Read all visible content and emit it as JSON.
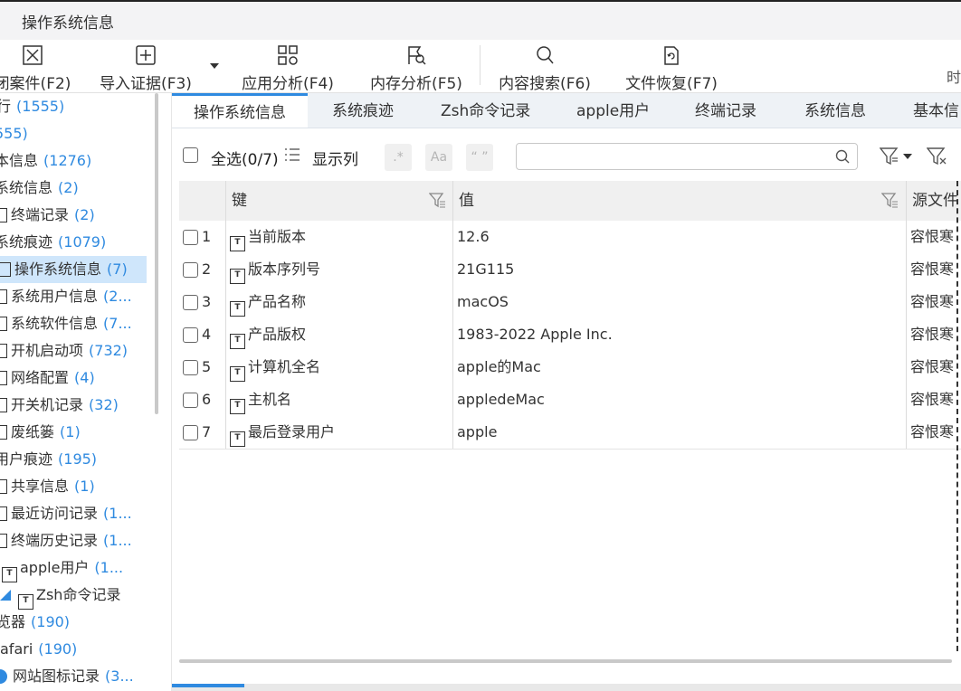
{
  "window": {
    "title": "操作系统信息"
  },
  "toolbar": {
    "buttons": [
      {
        "label": "闭案件(F2)",
        "icon": "close-box-icon"
      },
      {
        "label": "导入证据(F3)",
        "icon": "plus-box-icon"
      },
      {
        "label": "应用分析(F4)",
        "icon": "apps-grid-icon"
      },
      {
        "label": "内存分析(F5)",
        "icon": "memory-flag-icon"
      },
      {
        "label": "内容搜索(F6)",
        "icon": "search-icon"
      },
      {
        "label": "文件恢复(F7)",
        "icon": "file-recover-icon"
      }
    ],
    "edge_label": "时"
  },
  "sidebar": {
    "items": [
      {
        "label": "行",
        "count": "(1555)"
      },
      {
        "label": "",
        "count": "555)"
      },
      {
        "label": "本信息",
        "count": "(1276)"
      },
      {
        "label": "系统信息",
        "count": "(2)"
      },
      {
        "label": "终端记录",
        "count": "(2)"
      },
      {
        "label": "系统痕迹",
        "count": "(1079)"
      },
      {
        "label": "操作系统信息",
        "count": "(7)"
      },
      {
        "label": "系统用户信息",
        "count": "(2..."
      },
      {
        "label": "系统软件信息",
        "count": "(7..."
      },
      {
        "label": "开机启动项",
        "count": "(732)"
      },
      {
        "label": "网络配置",
        "count": "(4)"
      },
      {
        "label": "开关机记录",
        "count": "(32)"
      },
      {
        "label": "废纸篓",
        "count": "(1)"
      },
      {
        "label": "用户痕迹",
        "count": "(195)"
      },
      {
        "label": "共享信息",
        "count": "(1)"
      },
      {
        "label": "最近访问记录",
        "count": "(1..."
      },
      {
        "label": "终端历史记录",
        "count": "(1..."
      },
      {
        "label": "apple用户",
        "count": "(1..."
      },
      {
        "label": "Zsh命令记录",
        "count": ""
      },
      {
        "label": "览器",
        "count": "(190)"
      },
      {
        "label": "afari",
        "count": "(190)"
      },
      {
        "label": "网站图标记录",
        "count": "(3..."
      }
    ]
  },
  "tabs": [
    {
      "label": "操作系统信息",
      "active": true
    },
    {
      "label": "系统痕迹"
    },
    {
      "label": "Zsh命令记录"
    },
    {
      "label": "apple用户"
    },
    {
      "label": "终端记录"
    },
    {
      "label": "系统信息"
    },
    {
      "label": "基本信"
    }
  ],
  "filterbar": {
    "select_all": "全选(0/7)",
    "show_columns": "显示列",
    "regex_btn": ".*",
    "case_btn": "Aa",
    "quote_btn": "“ ”",
    "search_placeholder": ""
  },
  "table": {
    "columns": [
      "键",
      "值",
      "源文件"
    ],
    "rows": [
      {
        "num": "1",
        "key": "当前版本",
        "value": "12.6",
        "source": "容恨寒"
      },
      {
        "num": "2",
        "key": "版本序列号",
        "value": "21G115",
        "source": "容恨寒"
      },
      {
        "num": "3",
        "key": "产品名称",
        "value": "macOS",
        "source": "容恨寒"
      },
      {
        "num": "4",
        "key": "产品版权",
        "value": "1983-2022 Apple Inc.",
        "source": "容恨寒"
      },
      {
        "num": "5",
        "key": "计算机全名",
        "value": "apple的Mac",
        "source": "容恨寒"
      },
      {
        "num": "6",
        "key": "主机名",
        "value": "appledeMac",
        "source": "容恨寒"
      },
      {
        "num": "7",
        "key": "最后登录用户",
        "value": "apple",
        "source": "容恨寒"
      }
    ]
  },
  "colors": {
    "accent": "#2f8ae0",
    "selected": "#cfe6fb"
  }
}
